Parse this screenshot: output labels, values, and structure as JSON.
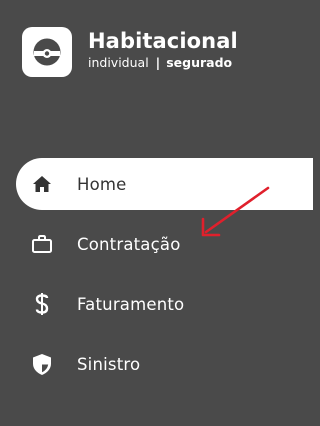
{
  "brand": {
    "title": "Habitacional",
    "subtitle_type": "individual",
    "subtitle_separator": "|",
    "subtitle_role": "segurado",
    "logo_icon": "product-logo-icon"
  },
  "nav": {
    "items": [
      {
        "label": "Home",
        "icon": "home-icon",
        "active": true
      },
      {
        "label": "Contratação",
        "icon": "briefcase-icon",
        "active": false
      },
      {
        "label": "Faturamento",
        "icon": "dollar-icon",
        "active": false
      },
      {
        "label": "Sinistro",
        "icon": "shield-icon",
        "active": false
      }
    ]
  },
  "colors": {
    "sidebar_bg": "#4a4a4a",
    "active_bg": "#ffffff",
    "annotation_arrow": "#e0202c"
  }
}
